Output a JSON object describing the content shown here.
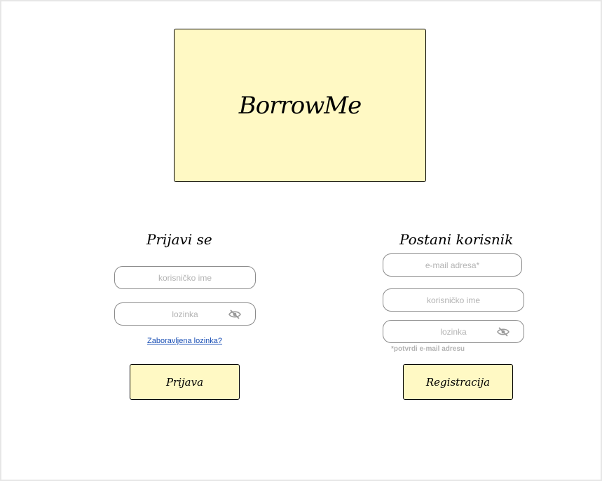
{
  "logo": {
    "text": "BorrowMe"
  },
  "login": {
    "title": "Prijavi se",
    "username_placeholder": "korisničko ime",
    "password_placeholder": "lozinka",
    "forgot_link": "Zaboravljena lozinka?",
    "submit_label": "Prijava"
  },
  "register": {
    "title": "Postani korisnik",
    "email_placeholder": "e-mail adresa*",
    "username_placeholder": "korisničko ime",
    "password_placeholder": "lozinka",
    "note": "*potvrdi e-mail adresu",
    "submit_label": "Registracija"
  },
  "icons": {
    "password_toggle": "eye-off-icon"
  },
  "colors": {
    "accent_fill": "#fff9c4",
    "placeholder": "#b3b3b3",
    "link": "#1a4fb5"
  }
}
